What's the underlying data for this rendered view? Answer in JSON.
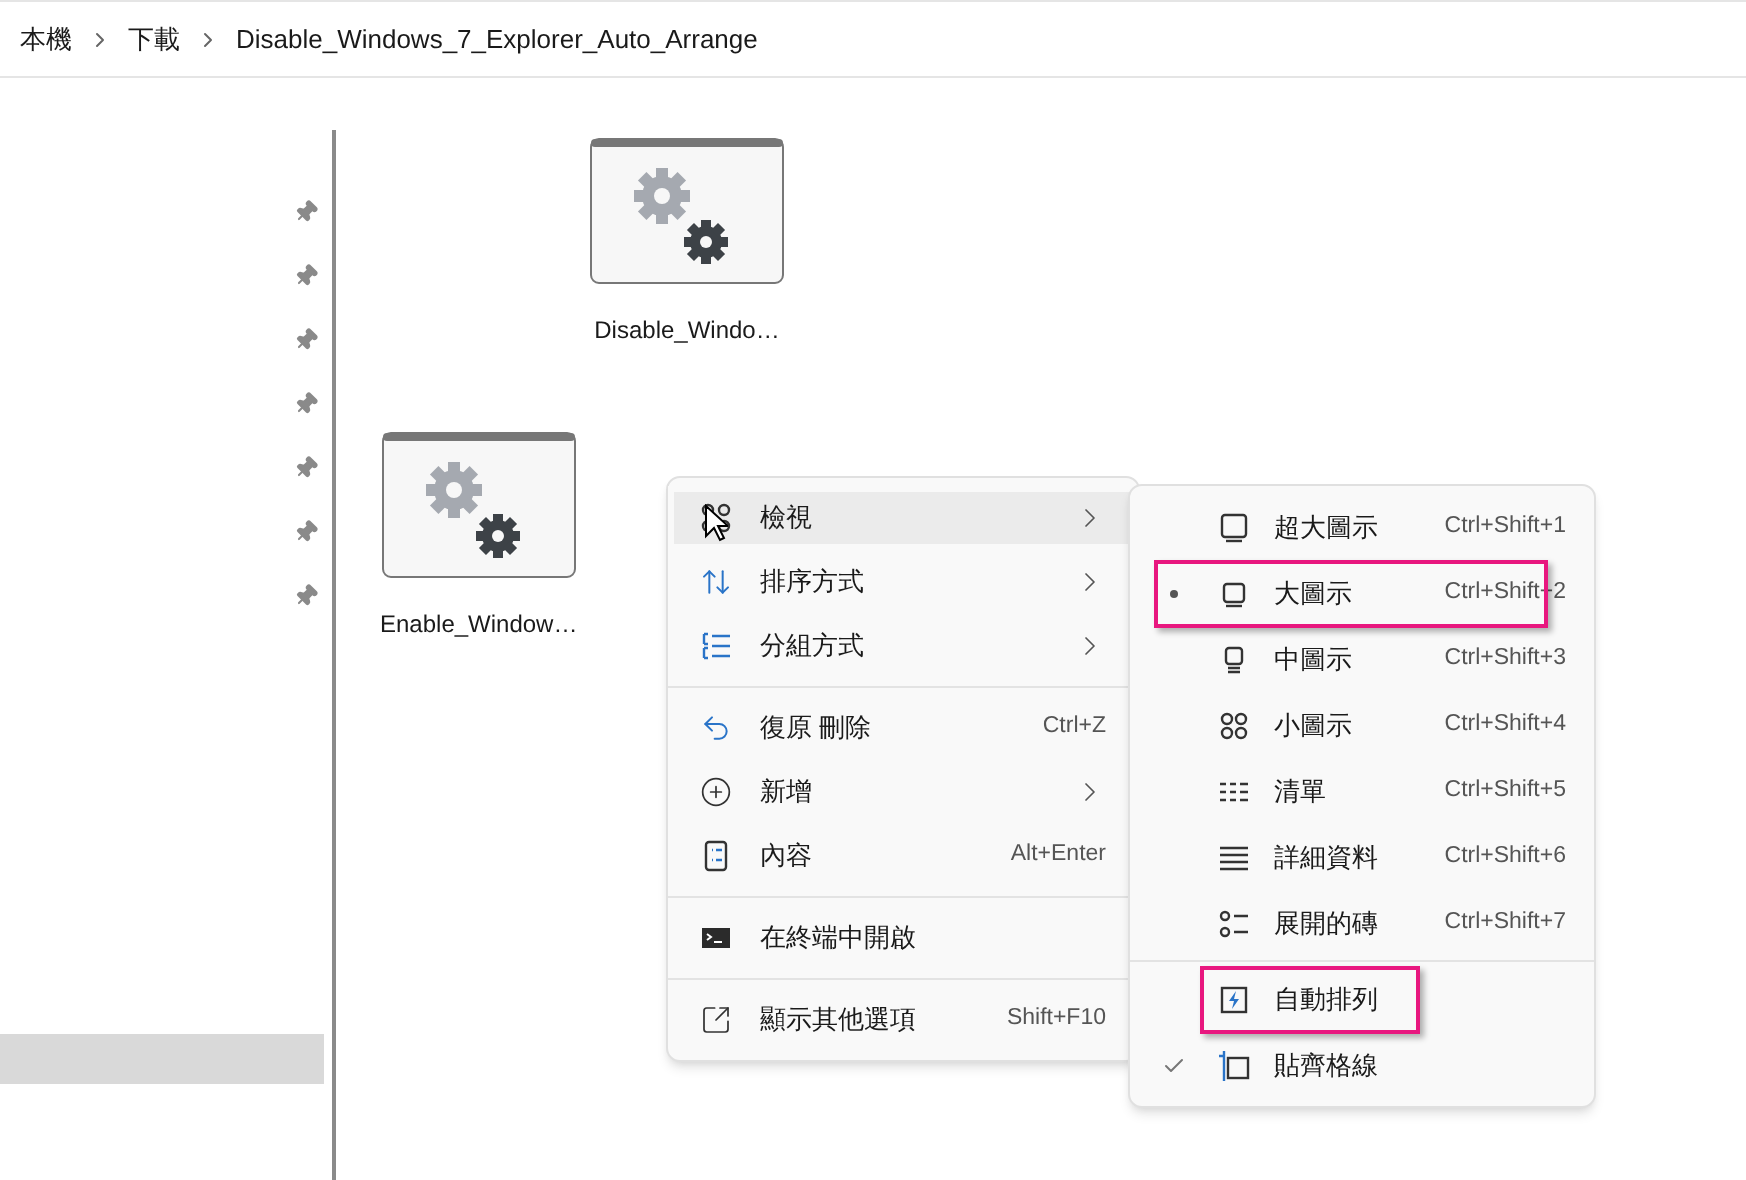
{
  "breadcrumb": [
    "本機",
    "下載",
    "Disable_Windows_7_Explorer_Auto_Arrange"
  ],
  "nav_items": [
    {
      "pinned": true,
      "selected": false
    },
    {
      "pinned": true,
      "selected": false
    },
    {
      "pinned": true,
      "selected": false
    },
    {
      "pinned": true,
      "selected": false
    },
    {
      "pinned": true,
      "selected": false
    },
    {
      "pinned": true,
      "selected": false
    },
    {
      "pinned": true,
      "selected": false
    },
    {
      "pinned": false,
      "selected": true
    }
  ],
  "files": [
    {
      "name": "Disable_Windo…"
    },
    {
      "name": "Enable_Window…"
    }
  ],
  "context_menu": [
    {
      "label": "檢視",
      "submenu": true,
      "hovered": true,
      "separator_before": false
    },
    {
      "label": "排序方式",
      "submenu": true,
      "hovered": false,
      "separator_before": false
    },
    {
      "label": "分組方式",
      "submenu": true,
      "hovered": false,
      "separator_before": false
    },
    {
      "label": "復原 刪除",
      "shortcut": "Ctrl+Z",
      "submenu": false,
      "hovered": false,
      "separator_before": true
    },
    {
      "label": "新增",
      "submenu": true,
      "hovered": false,
      "separator_before": false
    },
    {
      "label": "內容",
      "shortcut": "Alt+Enter",
      "submenu": false,
      "hovered": false,
      "separator_before": false
    },
    {
      "label": "在終端中開啟",
      "submenu": false,
      "hovered": false,
      "separator_before": true
    },
    {
      "label": "顯示其他選項",
      "shortcut": "Shift+F10",
      "submenu": false,
      "hovered": false,
      "separator_before": true
    }
  ],
  "view_submenu": [
    {
      "kind": "radio",
      "label": "超大圖示",
      "shortcut": "Ctrl+Shift+1",
      "selected": false,
      "annotated": false
    },
    {
      "kind": "radio",
      "label": "大圖示",
      "shortcut": "Ctrl+Shift+2",
      "selected": true,
      "annotated": true
    },
    {
      "kind": "radio",
      "label": "中圖示",
      "shortcut": "Ctrl+Shift+3",
      "selected": false,
      "annotated": false
    },
    {
      "kind": "radio",
      "label": "小圖示",
      "shortcut": "Ctrl+Shift+4",
      "selected": false,
      "annotated": false
    },
    {
      "kind": "radio",
      "label": "清單",
      "shortcut": "Ctrl+Shift+5",
      "selected": false,
      "annotated": false
    },
    {
      "kind": "radio",
      "label": "詳細資料",
      "shortcut": "Ctrl+Shift+6",
      "selected": false,
      "annotated": false
    },
    {
      "kind": "radio",
      "label": "展開的磚",
      "shortcut": "Ctrl+Shift+7",
      "selected": false,
      "annotated": false
    },
    {
      "kind": "toggle",
      "label": "自動排列",
      "checked": false,
      "annotated": true
    },
    {
      "kind": "toggle",
      "label": "貼齊格線",
      "checked": true,
      "annotated": false
    }
  ]
}
